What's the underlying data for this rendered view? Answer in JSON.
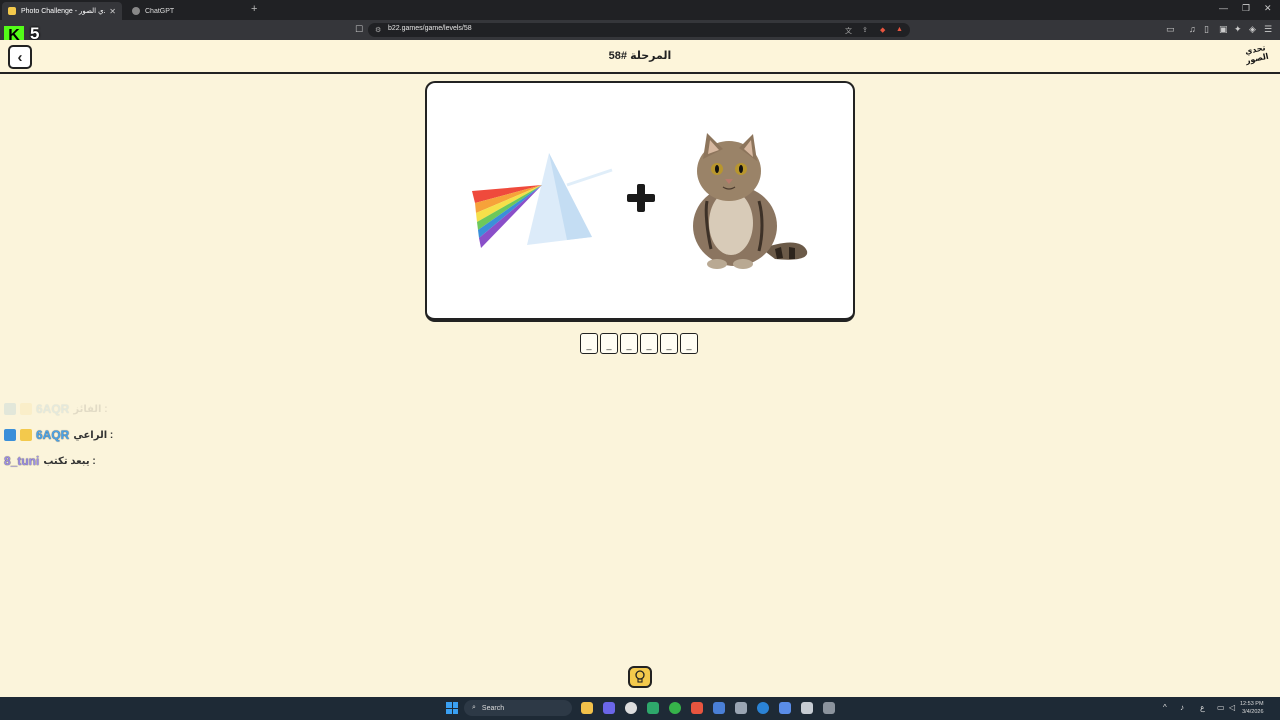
{
  "browser": {
    "tabs": [
      {
        "title": "Photo Challenge - تحدي الصور",
        "active": true
      },
      {
        "title": "ChatGPT",
        "active": false
      }
    ],
    "url": "b22.games/game/levels/58"
  },
  "stream_overlay": {
    "kick_number": "5",
    "brand_color": "#53fc18"
  },
  "game": {
    "title": "المرحلة #58",
    "logo_text_top": "تحدي",
    "logo_text_bottom": "الصور",
    "puzzle": {
      "left_image": "prism-rainbow",
      "operator": "+",
      "right_image": "cat"
    },
    "answer_slots": [
      "_",
      "_",
      "_",
      "_",
      "_",
      "_"
    ],
    "hint_icon": "lightbulb-icon"
  },
  "chat": [
    {
      "user": "6AQR",
      "label": "الفائز :",
      "faded": true
    },
    {
      "user": "6AQR",
      "label": "الراعي :",
      "faded": false
    },
    {
      "user": "8_tuni",
      "label": "يبعد تكتب :",
      "faded": false
    }
  ],
  "taskbar": {
    "search_placeholder": "Search",
    "time": "12:53 PM",
    "date": "3/4/2026",
    "lang": "ع"
  },
  "colors": {
    "page_bg": "#fbf4db",
    "hint_bg": "#f3c94c",
    "taskbar_bg": "#1e2a36"
  }
}
